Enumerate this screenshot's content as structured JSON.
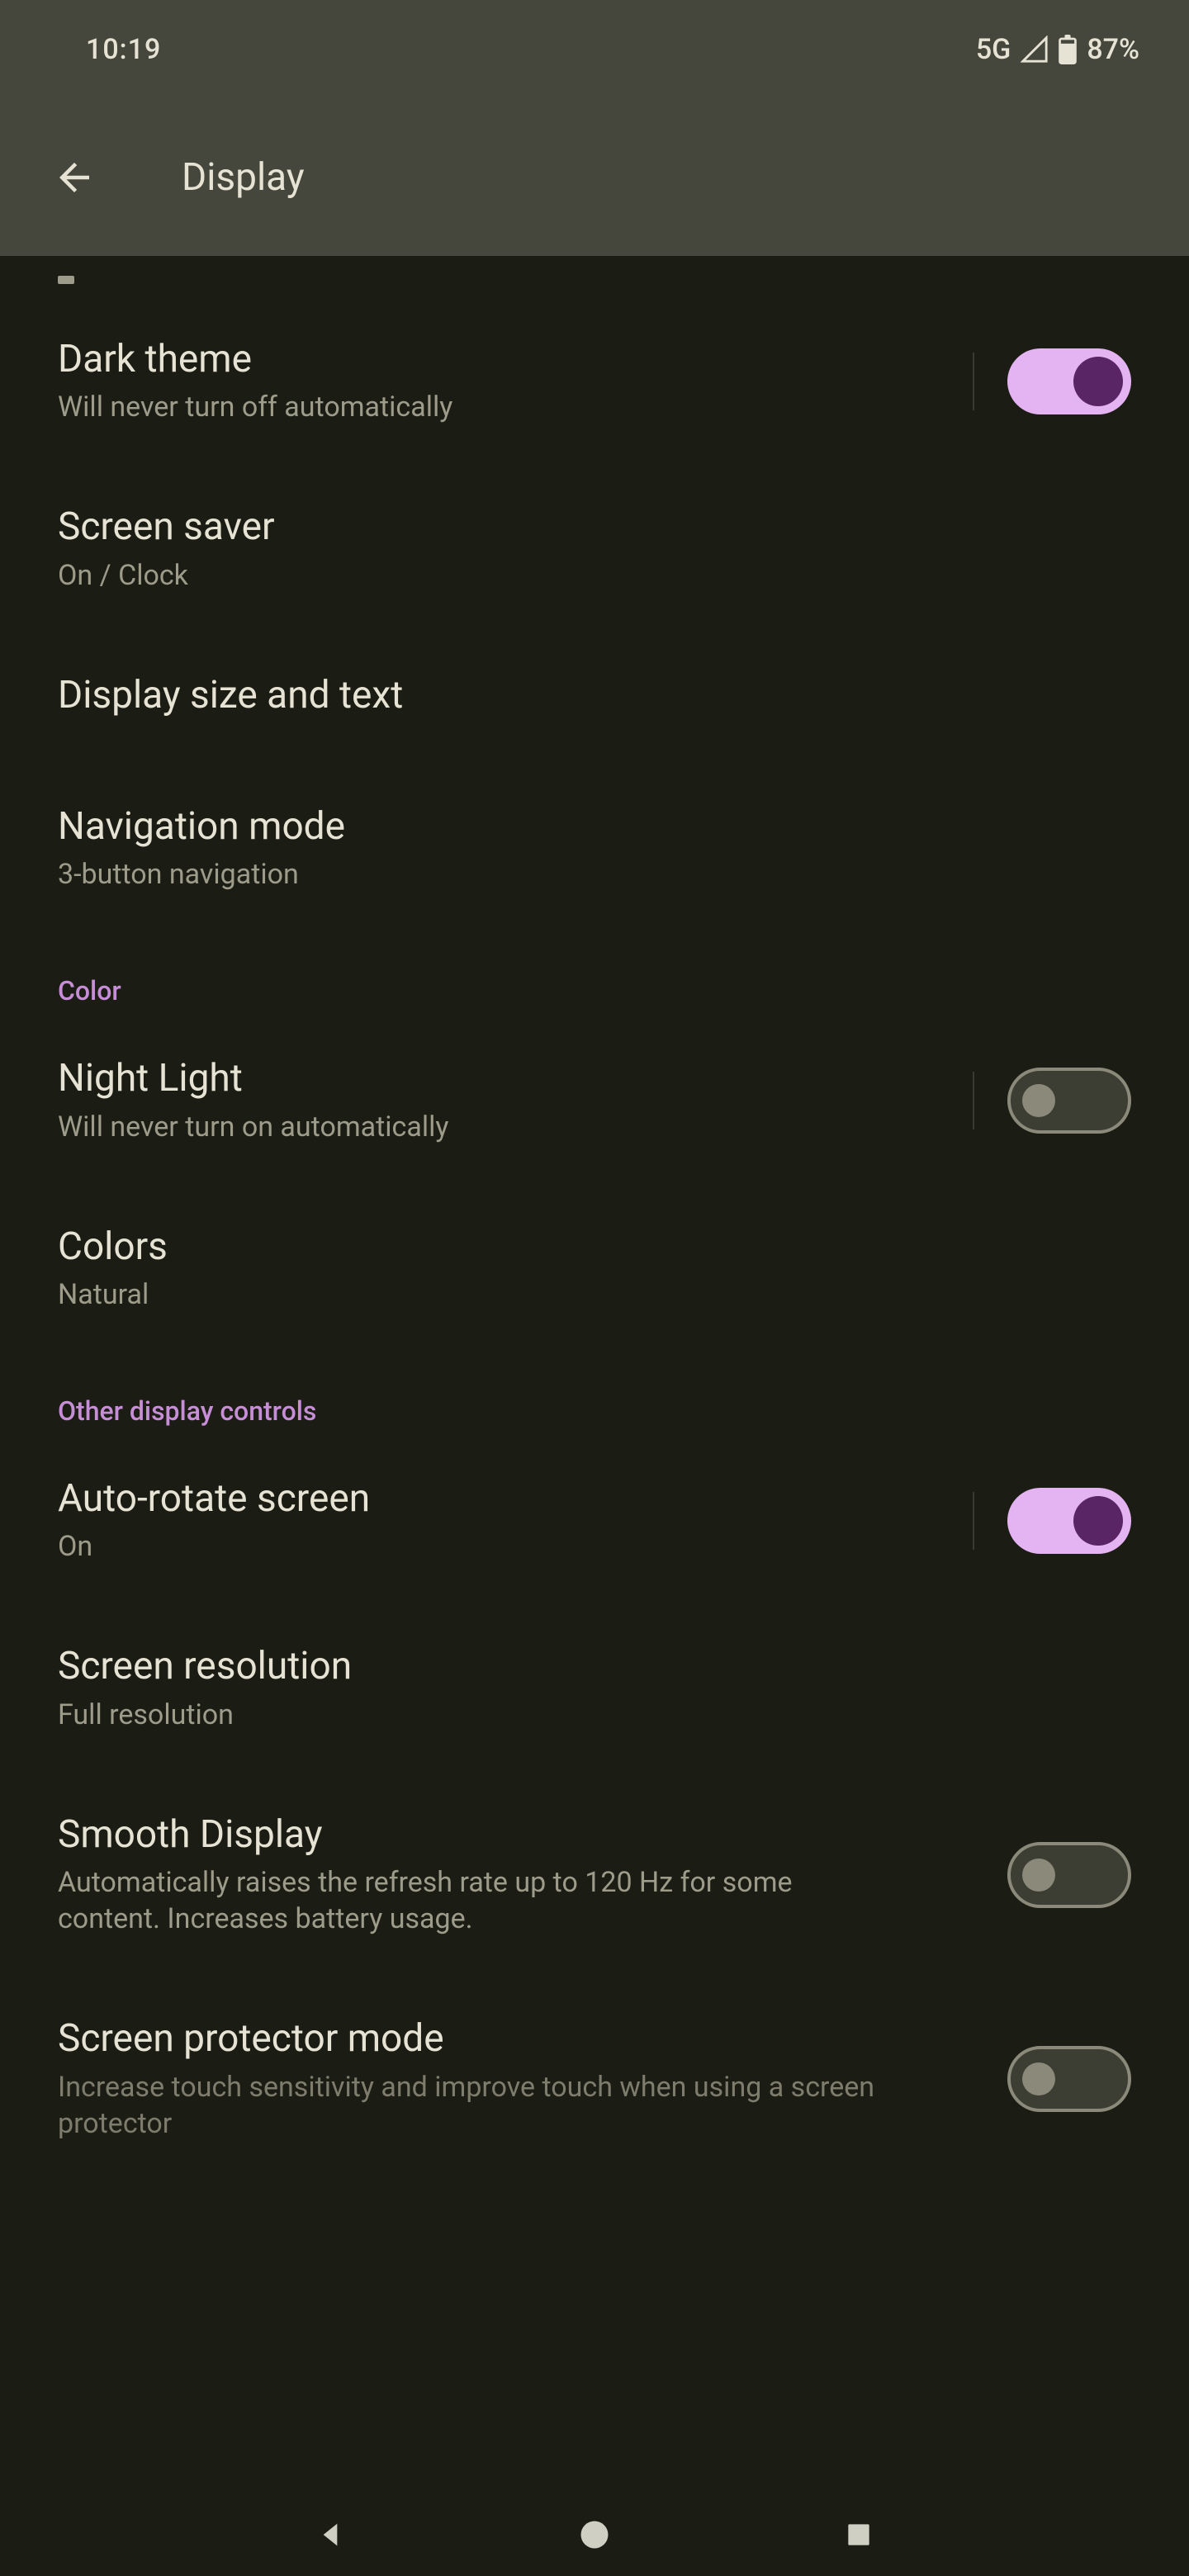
{
  "status": {
    "time": "10:19",
    "network": "5G",
    "battery": "87%"
  },
  "app_bar": {
    "title": "Display"
  },
  "sections": {
    "general": {
      "dark_theme": {
        "title": "Dark theme",
        "sub": "Will never turn off automatically",
        "on": true
      },
      "screen_saver": {
        "title": "Screen saver",
        "sub": "On / Clock"
      },
      "display_size": {
        "title": "Display size and text"
      },
      "nav_mode": {
        "title": "Navigation mode",
        "sub": "3-button navigation"
      }
    },
    "color_header": "Color",
    "color": {
      "night_light": {
        "title": "Night Light",
        "sub": "Will never turn on automatically",
        "on": false
      },
      "colors": {
        "title": "Colors",
        "sub": "Natural"
      }
    },
    "other_header": "Other display controls",
    "other": {
      "auto_rotate": {
        "title": "Auto-rotate screen",
        "sub": "On",
        "on": true
      },
      "screen_res": {
        "title": "Screen resolution",
        "sub": "Full resolution"
      },
      "smooth": {
        "title": "Smooth Display",
        "sub": "Automatically raises the refresh rate up to 120 Hz for some content. Increases battery usage.",
        "on": false
      },
      "protector": {
        "title": "Screen protector mode",
        "sub": "Increase touch sensitivity and improve touch when using a screen protector",
        "on": false
      }
    }
  }
}
